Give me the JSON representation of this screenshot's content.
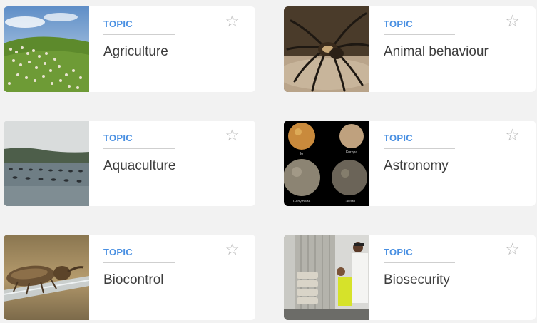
{
  "cards": [
    {
      "kicker": "TOPIC",
      "title": "Agriculture",
      "star_icon": "☆",
      "image": "sheep-on-hillside"
    },
    {
      "kicker": "TOPIC",
      "title": "Animal behaviour",
      "star_icon": "☆",
      "image": "spider-on-rock"
    },
    {
      "kicker": "TOPIC",
      "title": "Aquaculture",
      "star_icon": "☆",
      "image": "mussel-farm-buoys"
    },
    {
      "kicker": "TOPIC",
      "title": "Astronomy",
      "star_icon": "☆",
      "image": "galilean-moons",
      "image_labels": [
        "Io",
        "Europa",
        "Ganymede",
        "Callisto"
      ]
    },
    {
      "kicker": "TOPIC",
      "title": "Biocontrol",
      "star_icon": "☆",
      "image": "weevil-on-stem"
    },
    {
      "kicker": "TOPIC",
      "title": "Biosecurity",
      "star_icon": "☆",
      "image": "container-inspection"
    }
  ],
  "colors": {
    "kicker": "#4a90e2",
    "background": "#f2f2f2",
    "card": "#ffffff",
    "star": "#b9b9b9"
  }
}
